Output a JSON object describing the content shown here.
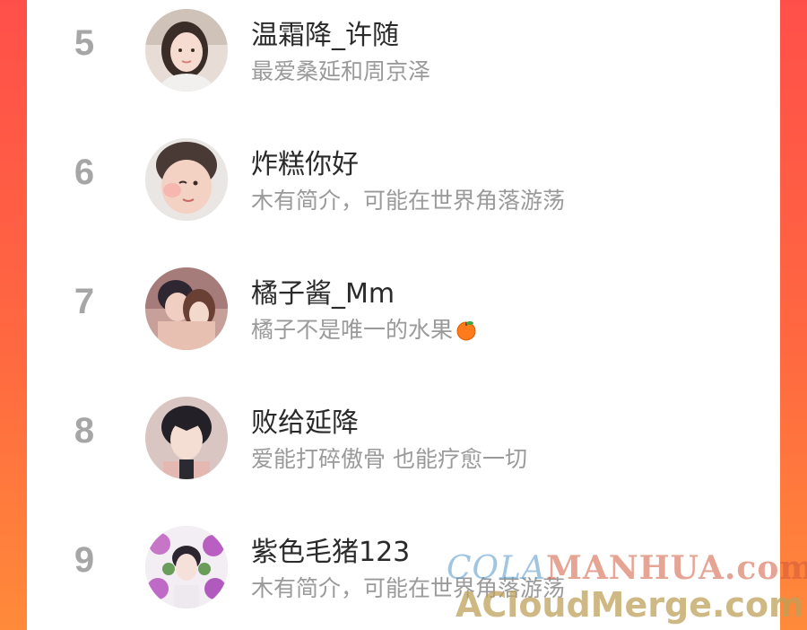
{
  "leaderboard": {
    "entries": [
      {
        "rank": "5",
        "name": "温霜降_许随",
        "bio": "最爱桑延和周京泽"
      },
      {
        "rank": "6",
        "name": "炸糕你好",
        "bio": "木有简介，可能在世界角落游荡"
      },
      {
        "rank": "7",
        "name": "橘子酱_Mm",
        "bio": "橘子不是唯一的水果",
        "bio_emoji": "orange-emoji"
      },
      {
        "rank": "8",
        "name": "败给延降",
        "bio": "爱能打碎傲骨 也能疗愈一切"
      },
      {
        "rank": "9",
        "name": "紫色毛猪123",
        "bio": "木有简介，可能在世界角落游荡"
      }
    ]
  },
  "watermark": {
    "line1_a": "COLA",
    "line1_b": "MANHUA.com",
    "line2": "ACloudMerge.com"
  },
  "colors": {
    "background_gradient_top": "#ff4f4a",
    "background_gradient_bottom": "#ff8a3a",
    "rank": "#a6a6a6",
    "name": "#2a2a2a",
    "bio": "#9a9a9a"
  }
}
